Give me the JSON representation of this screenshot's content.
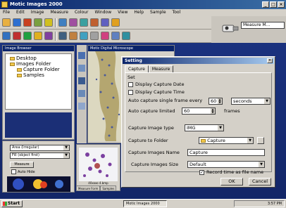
{
  "app": {
    "title": "Motic Images 2000"
  },
  "menu": [
    "File",
    "Edit",
    "Image",
    "Measure",
    "Colour",
    "Window",
    "View",
    "Help",
    "Sample",
    "Tool"
  ],
  "toolbar": {
    "row1": [
      "#e8b040",
      "#2e6fd0",
      "#c84020",
      "#7aa040",
      "#d0c020",
      "#4080c0",
      "#a050a0",
      "#3aa0a0",
      "#c06030",
      "#6060c0",
      "#e0a020"
    ],
    "row2": [
      "#3070c0",
      "#c03030",
      "#20a040",
      "#e0b020",
      "#8040a0",
      "#406080",
      "#c08040",
      "#40a0c0",
      "#a0a0a0",
      "#d04080",
      "#6080c0",
      "#3090a0"
    ]
  },
  "right_pane": {
    "measure_box": "Measure M..."
  },
  "tree_panel": {
    "title": "Image Browser",
    "items": [
      {
        "label": "Desktop",
        "indent": 0
      },
      {
        "label": "Images Folder",
        "indent": 0
      },
      {
        "label": "Capture Folder",
        "indent": 1
      },
      {
        "label": "Samples",
        "indent": 1
      }
    ]
  },
  "bottom_panel": {
    "combo1": "Area (Irregular)",
    "combo2": "Fill (object first)",
    "measure_label": "Measure",
    "autohide_label": "Auto Hide"
  },
  "image_window": {
    "title": "Motic Digital Microscope"
  },
  "thumbnail": {
    "caption": "40xoxo 4.bmp",
    "tabs": [
      "Measure Form",
      "Samples"
    ]
  },
  "dialog": {
    "title": "Setting",
    "tabs": [
      "Capture",
      "Measure"
    ],
    "section_label": "Set",
    "display_capture_date": "Display Capture Date",
    "display_capture_time": "Display Capture Time",
    "auto_single_label": "Auto capture single frame every",
    "auto_single_value": "60",
    "auto_single_unit": "seconds",
    "auto_limited_label": "Auto capture limited",
    "auto_limited_value": "60",
    "auto_limited_unit": "frames",
    "image_type_label": "Capture Image type",
    "image_type_value": "IMG",
    "folder_label": "Capture to Folder",
    "folder_value": "Capture",
    "images_name_label": "Capture Images Name",
    "images_name_value": "Capture",
    "images_size_label": "Capture Images Size",
    "images_size_value": "Default",
    "record_time_label": "Record time as file name",
    "ok_label": "OK",
    "cancel_label": "Cancel"
  },
  "taskbar": {
    "start_label": "Start",
    "task_label": "Motic Images 2000",
    "clock": "3:57 PM"
  }
}
